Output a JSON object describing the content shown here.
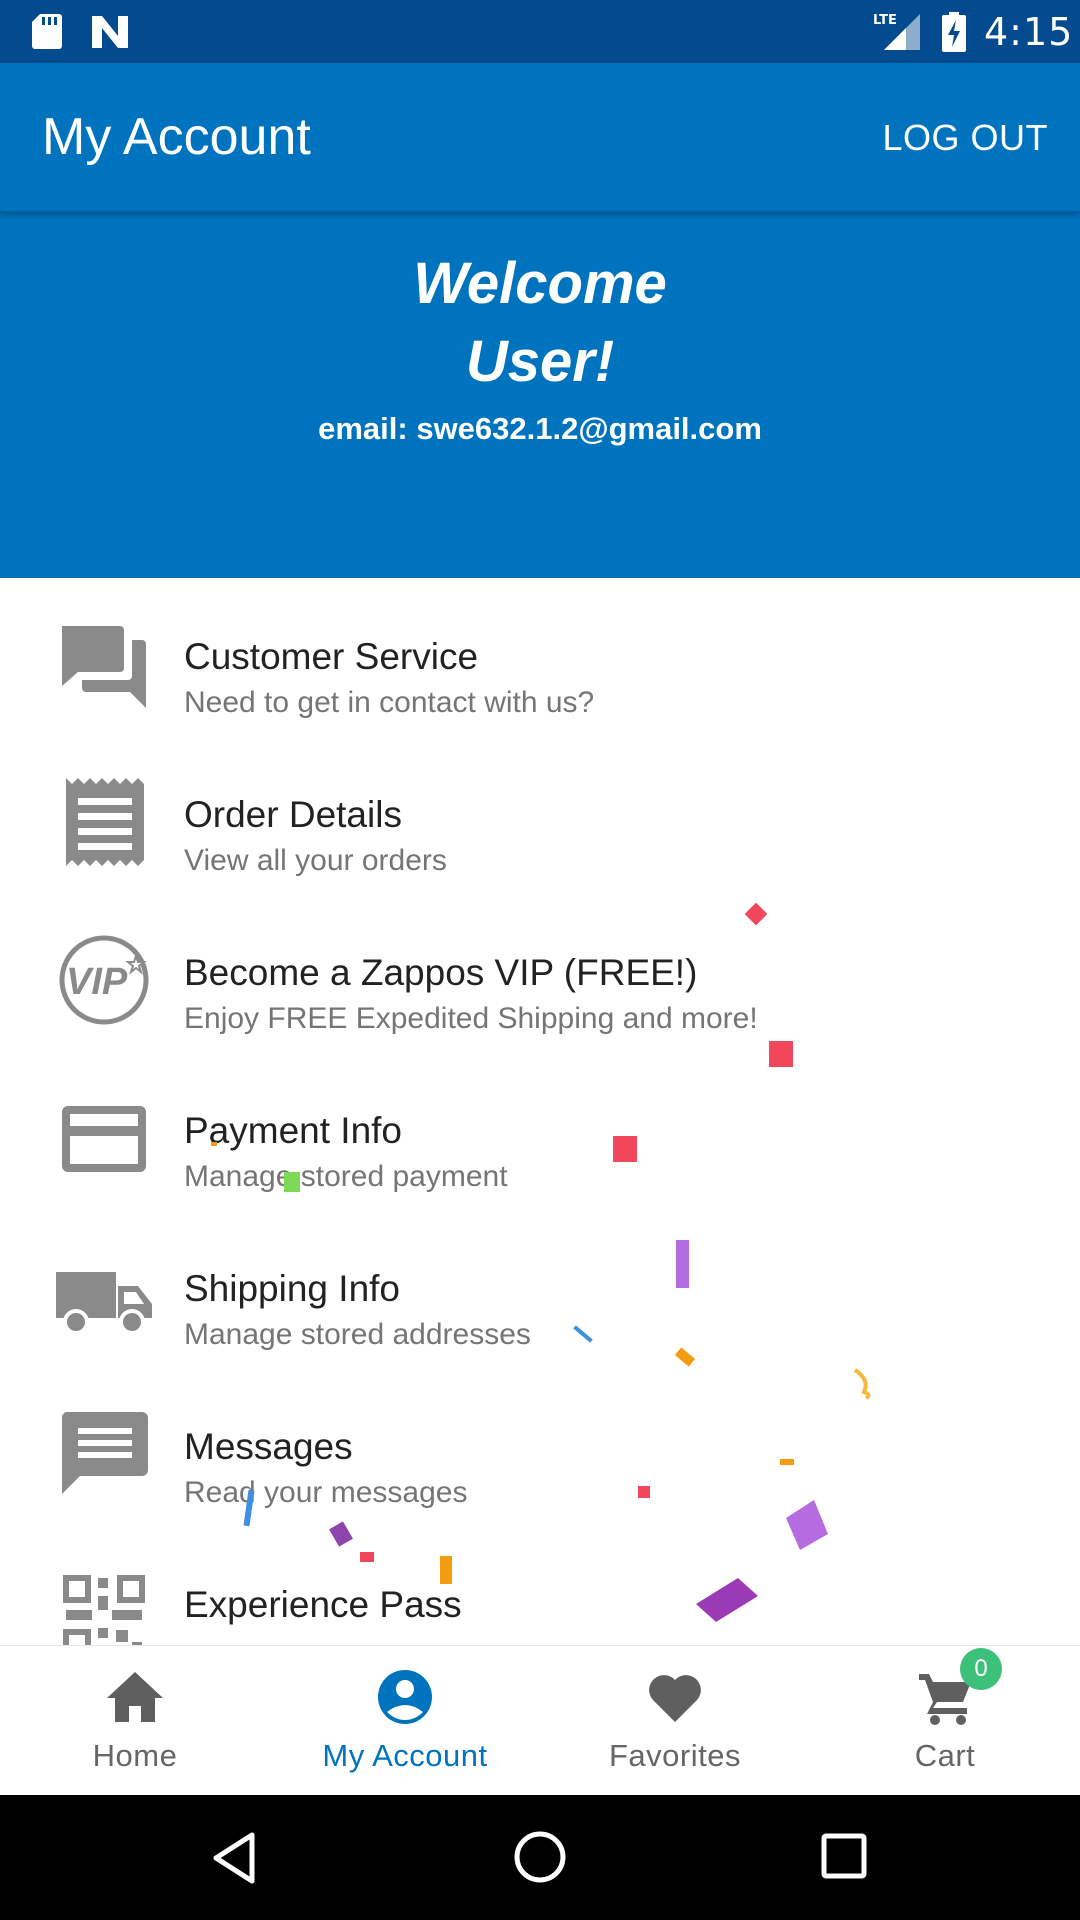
{
  "status_bar": {
    "time": "4:15",
    "network": "LTE",
    "icons": [
      "sd-card-icon",
      "n-notification-icon",
      "lte-signal-icon",
      "battery-charging-icon"
    ]
  },
  "app_bar": {
    "title": "My Account",
    "logout_label": "LOG OUT"
  },
  "welcome": {
    "line1": "Welcome",
    "line2": "User!",
    "email_label": "email:",
    "email_value": "swe632.1.2@gmail.com"
  },
  "menu": {
    "items": [
      {
        "title": "Customer Service",
        "subtitle": "Need to get in contact with us?",
        "icon": "chat-bubbles-icon"
      },
      {
        "title": "Order Details",
        "subtitle": "View all your orders",
        "icon": "receipt-icon"
      },
      {
        "title": "Become a Zappos VIP (FREE!)",
        "subtitle": "Enjoy FREE Expedited Shipping and more!",
        "icon": "vip-badge-icon"
      },
      {
        "title": "Payment Info",
        "subtitle": "Manage stored payment",
        "icon": "credit-card-icon"
      },
      {
        "title": "Shipping Info",
        "subtitle": "Manage stored addresses",
        "icon": "truck-icon"
      },
      {
        "title": "Messages",
        "subtitle": "Read your messages",
        "icon": "message-icon"
      },
      {
        "title": "Experience Pass",
        "subtitle": "",
        "icon": "qr-code-icon"
      }
    ]
  },
  "bottom_nav": {
    "tabs": [
      {
        "label": "Home",
        "icon": "home-icon",
        "active": false
      },
      {
        "label": "My Account",
        "icon": "account-icon",
        "active": true
      },
      {
        "label": "Favorites",
        "icon": "heart-icon",
        "active": false
      },
      {
        "label": "Cart",
        "icon": "cart-icon",
        "active": false
      }
    ],
    "cart_count": "0"
  },
  "colors": {
    "brand_blue": "#0073bf",
    "status_bar": "#044a8e",
    "icon_gray": "#8a8a8a",
    "badge_green": "#3cc07a"
  }
}
